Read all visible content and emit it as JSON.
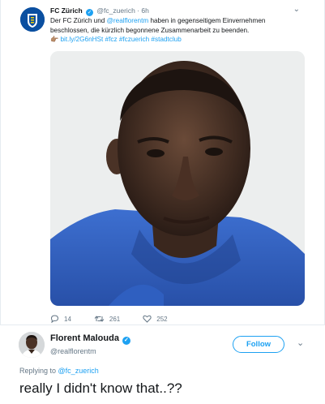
{
  "quoted_tweet": {
    "name": "FC Zürich",
    "handle": "@fc_zuerich",
    "time": "6h",
    "text_before": "Der FC Zürich und ",
    "mention": "@realflorentm",
    "text_after": " haben in gegenseitigem Einvernehmen beschlossen, die kürzlich begonnene Zusammenarbeit zu beenden.",
    "pointer_emoji": "👉🏽",
    "links": "bit.ly/2G6nHSt #fcz #fczuerich #stadtclub",
    "replies": "14",
    "retweets": "261",
    "likes": "252"
  },
  "reply_tweet": {
    "name": "Florent Malouda",
    "handle": "@realflorentm",
    "follow_label": "Follow",
    "replying_to_label": "Replying to",
    "replying_to_handle": "@fc_zuerich",
    "text": "really I didn't know that..??"
  },
  "colors": {
    "accent": "#1da1f2",
    "muted": "#657786",
    "text": "#14171a",
    "club_blue": "#0a4fa0"
  },
  "icons": [
    "club-logo-icon",
    "verified-icon",
    "chevron-down-icon",
    "reply-icon",
    "retweet-icon",
    "like-icon"
  ]
}
